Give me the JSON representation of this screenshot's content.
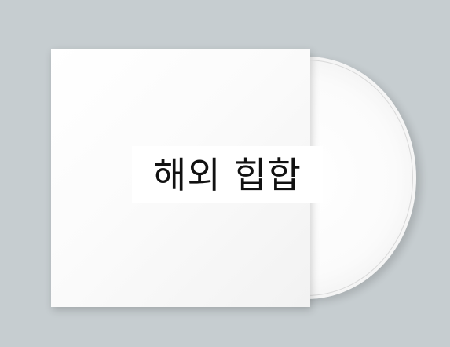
{
  "album": {
    "title": "해외 힙합"
  },
  "colors": {
    "background": "#c6cdd0",
    "sleeve": "#ffffff",
    "disc": "#ffffff",
    "text": "#111111"
  }
}
